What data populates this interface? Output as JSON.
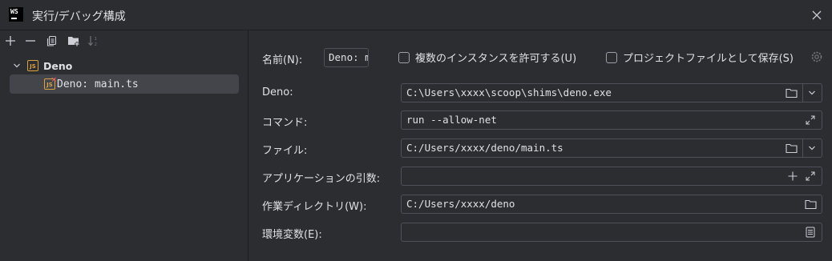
{
  "window": {
    "title": "実行/デバッグ構成",
    "app_logo_text": "WS"
  },
  "colors": {
    "background": "#2b2d30",
    "selection": "#43454a",
    "border": "#4e5157",
    "text": "#dfe1e5",
    "js_icon": "#d9a343",
    "icon": "#ced0d6"
  },
  "toolbar": {
    "icons": [
      "add-icon",
      "remove-icon",
      "copy-icon",
      "new-folder-icon",
      "sort-icon"
    ]
  },
  "tree": {
    "root": {
      "label": "Deno",
      "icon": "js-icon",
      "expanded": true
    },
    "child": {
      "label": "Deno: main.ts",
      "icon": "js-icon-error",
      "selected": true
    }
  },
  "form": {
    "name": {
      "label": "名前(N):",
      "value": "Deno: main.ts"
    },
    "allow_parallel": {
      "label": "複数のインスタンスを許可する(U)",
      "checked": false
    },
    "store_as_project_file": {
      "label": "プロジェクトファイルとして保存(S)",
      "checked": false
    },
    "deno": {
      "label": "Deno:",
      "value": "C:\\Users\\xxxx\\scoop\\shims\\deno.exe"
    },
    "command": {
      "label": "コマンド:",
      "value": "run --allow-net"
    },
    "file": {
      "label": "ファイル:",
      "value": "C:/Users/xxxx/deno/main.ts"
    },
    "app_args": {
      "label": "アプリケーションの引数:",
      "value": ""
    },
    "working_dir": {
      "label": "作業ディレクトリ(W):",
      "value": "C:/Users/xxxx/deno"
    },
    "env_vars": {
      "label": "環境変数(E):",
      "value": ""
    }
  }
}
